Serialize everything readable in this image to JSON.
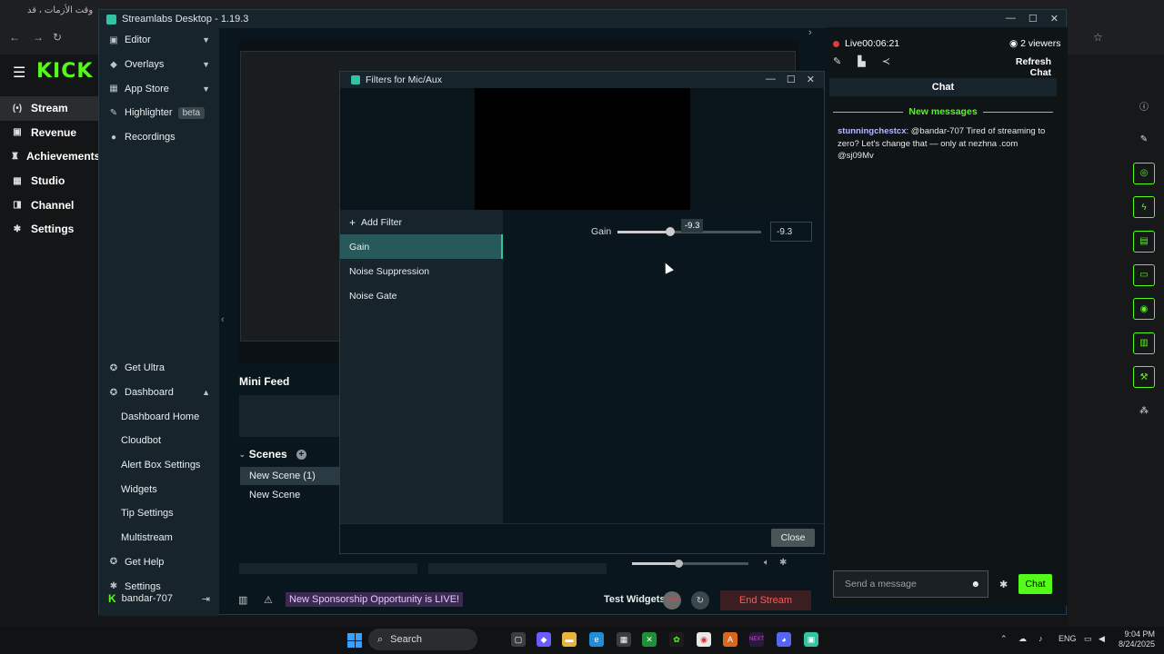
{
  "browser": {
    "tab_title": "وقت الأزمات ، قد",
    "kick_logo": "KICK",
    "nav": [
      {
        "label": "Stream",
        "icon": "broadcast-icon"
      },
      {
        "label": "Revenue",
        "icon": "revenue-icon"
      },
      {
        "label": "Achievements",
        "icon": "trophy-icon"
      },
      {
        "label": "Studio",
        "icon": "studio-icon"
      },
      {
        "label": "Channel",
        "icon": "channel-icon"
      },
      {
        "label": "Settings",
        "icon": "gear-icon"
      }
    ]
  },
  "streamlabs": {
    "title": "Streamlabs Desktop - 1.19.3",
    "sidebar": [
      {
        "label": "Editor",
        "icon": "editor-icon"
      },
      {
        "label": "Overlays",
        "icon": "overlays-icon"
      },
      {
        "label": "App Store",
        "icon": "app-store-icon"
      },
      {
        "label": "Highlighter",
        "icon": "highlighter-icon",
        "badge": "beta"
      },
      {
        "label": "Recordings",
        "icon": "recordings-icon"
      }
    ],
    "sidebar_bottom": [
      {
        "label": "Get Ultra",
        "icon": "ultra-icon",
        "sub": false
      },
      {
        "label": "Dashboard",
        "icon": "dashboard-icon",
        "sub": false
      },
      {
        "label": "Dashboard Home",
        "sub": true
      },
      {
        "label": "Cloudbot",
        "sub": true
      },
      {
        "label": "Alert Box Settings",
        "sub": true
      },
      {
        "label": "Widgets",
        "sub": true
      },
      {
        "label": "Tip Settings",
        "sub": true
      },
      {
        "label": "Multistream",
        "sub": true
      },
      {
        "label": "Get Help",
        "icon": "help-icon",
        "sub": false
      },
      {
        "label": "Settings",
        "icon": "gear-icon",
        "sub": false
      }
    ],
    "user": "bandar-707",
    "mini_feed_title": "Mini Feed",
    "scenes_title": "Scenes",
    "scenes": [
      "New Scene (1)",
      "New Scene"
    ],
    "promo": "New Sponsorship Opportunity is LIVE!",
    "test_widgets": "Test Widgets",
    "rec_label": "REC",
    "end_stream": "End Stream",
    "live_label": "Live",
    "live_time": "00:06:21",
    "viewers": "2 viewers",
    "refresh_chat": "Refresh Chat",
    "chat_header": "Chat",
    "new_messages": "New messages",
    "chat_messages": [
      {
        "user": "stunningchestcx",
        "text": ": @bandar-707 Tired of streaming to zero? Let's change that — only at nezhna .com @sj09Mv"
      }
    ],
    "chat_placeholder": "Send a message",
    "chat_send": "Chat",
    "mixer_level": 0.4
  },
  "dialog": {
    "title": "Filters for Mic/Aux",
    "add_filter": "Add Filter",
    "filters": [
      "Gain",
      "Noise Suppression",
      "Noise Gate"
    ],
    "selected_filter": "Gain",
    "gain_label": "Gain",
    "gain_value": "-9.3",
    "gain_level": 0.37,
    "close": "Close"
  },
  "taskbar": {
    "search": "Search",
    "lang": "ENG",
    "time": "9:04 PM",
    "date": "8/24/2025"
  }
}
